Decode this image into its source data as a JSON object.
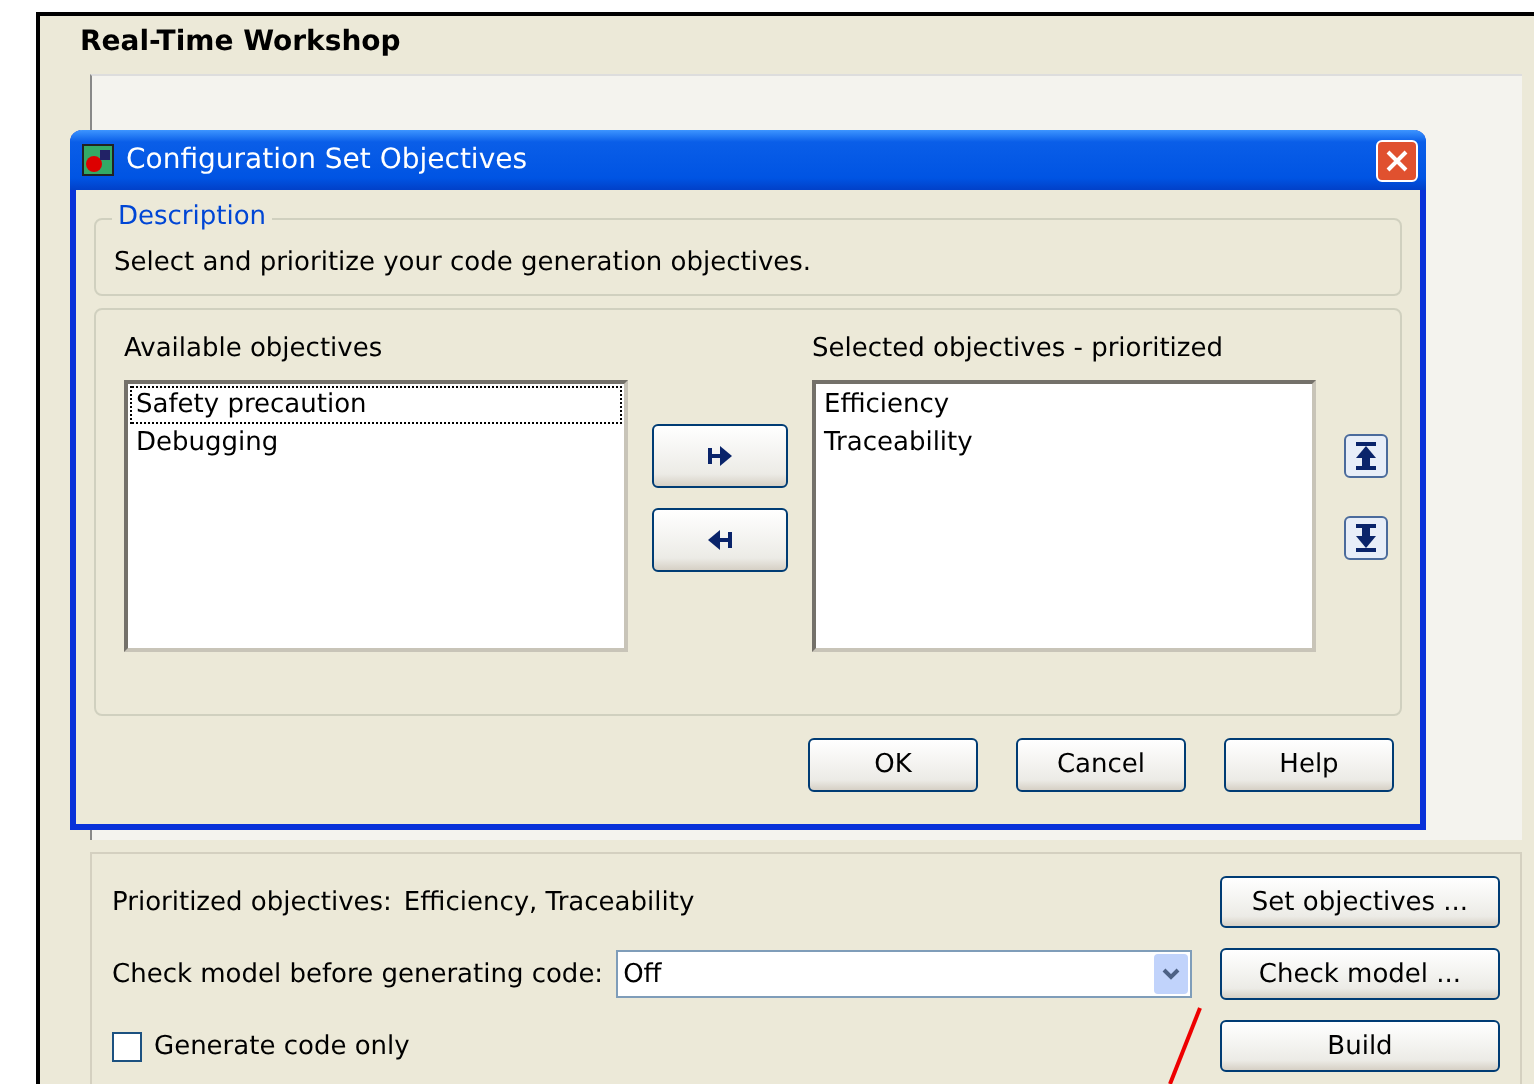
{
  "window": {
    "title": "Real-Time Workshop"
  },
  "dialog": {
    "title": "Configuration Set Objectives",
    "description": {
      "legend": "Description",
      "text": "Select and prioritize your code generation objectives."
    },
    "available": {
      "label": "Available objectives",
      "items": [
        {
          "text": "Safety precaution",
          "focused": true
        },
        {
          "text": "Debugging",
          "focused": false
        }
      ]
    },
    "selected": {
      "label": "Selected objectives - prioritized",
      "items": [
        {
          "text": "Efficiency",
          "focused": false
        },
        {
          "text": "Traceability",
          "focused": false
        }
      ]
    },
    "buttons": [
      "OK",
      "Cancel",
      "Help"
    ]
  },
  "prioritized": {
    "label": "Prioritized objectives:",
    "value": "Efficiency, Traceability"
  },
  "check_model": {
    "label": "Check model before generating code:",
    "value": "Off"
  },
  "generate_code_only": {
    "label": "Generate code only",
    "checked": false
  },
  "side_buttons": [
    "Set objectives ...",
    "Check model ...",
    "Build"
  ]
}
